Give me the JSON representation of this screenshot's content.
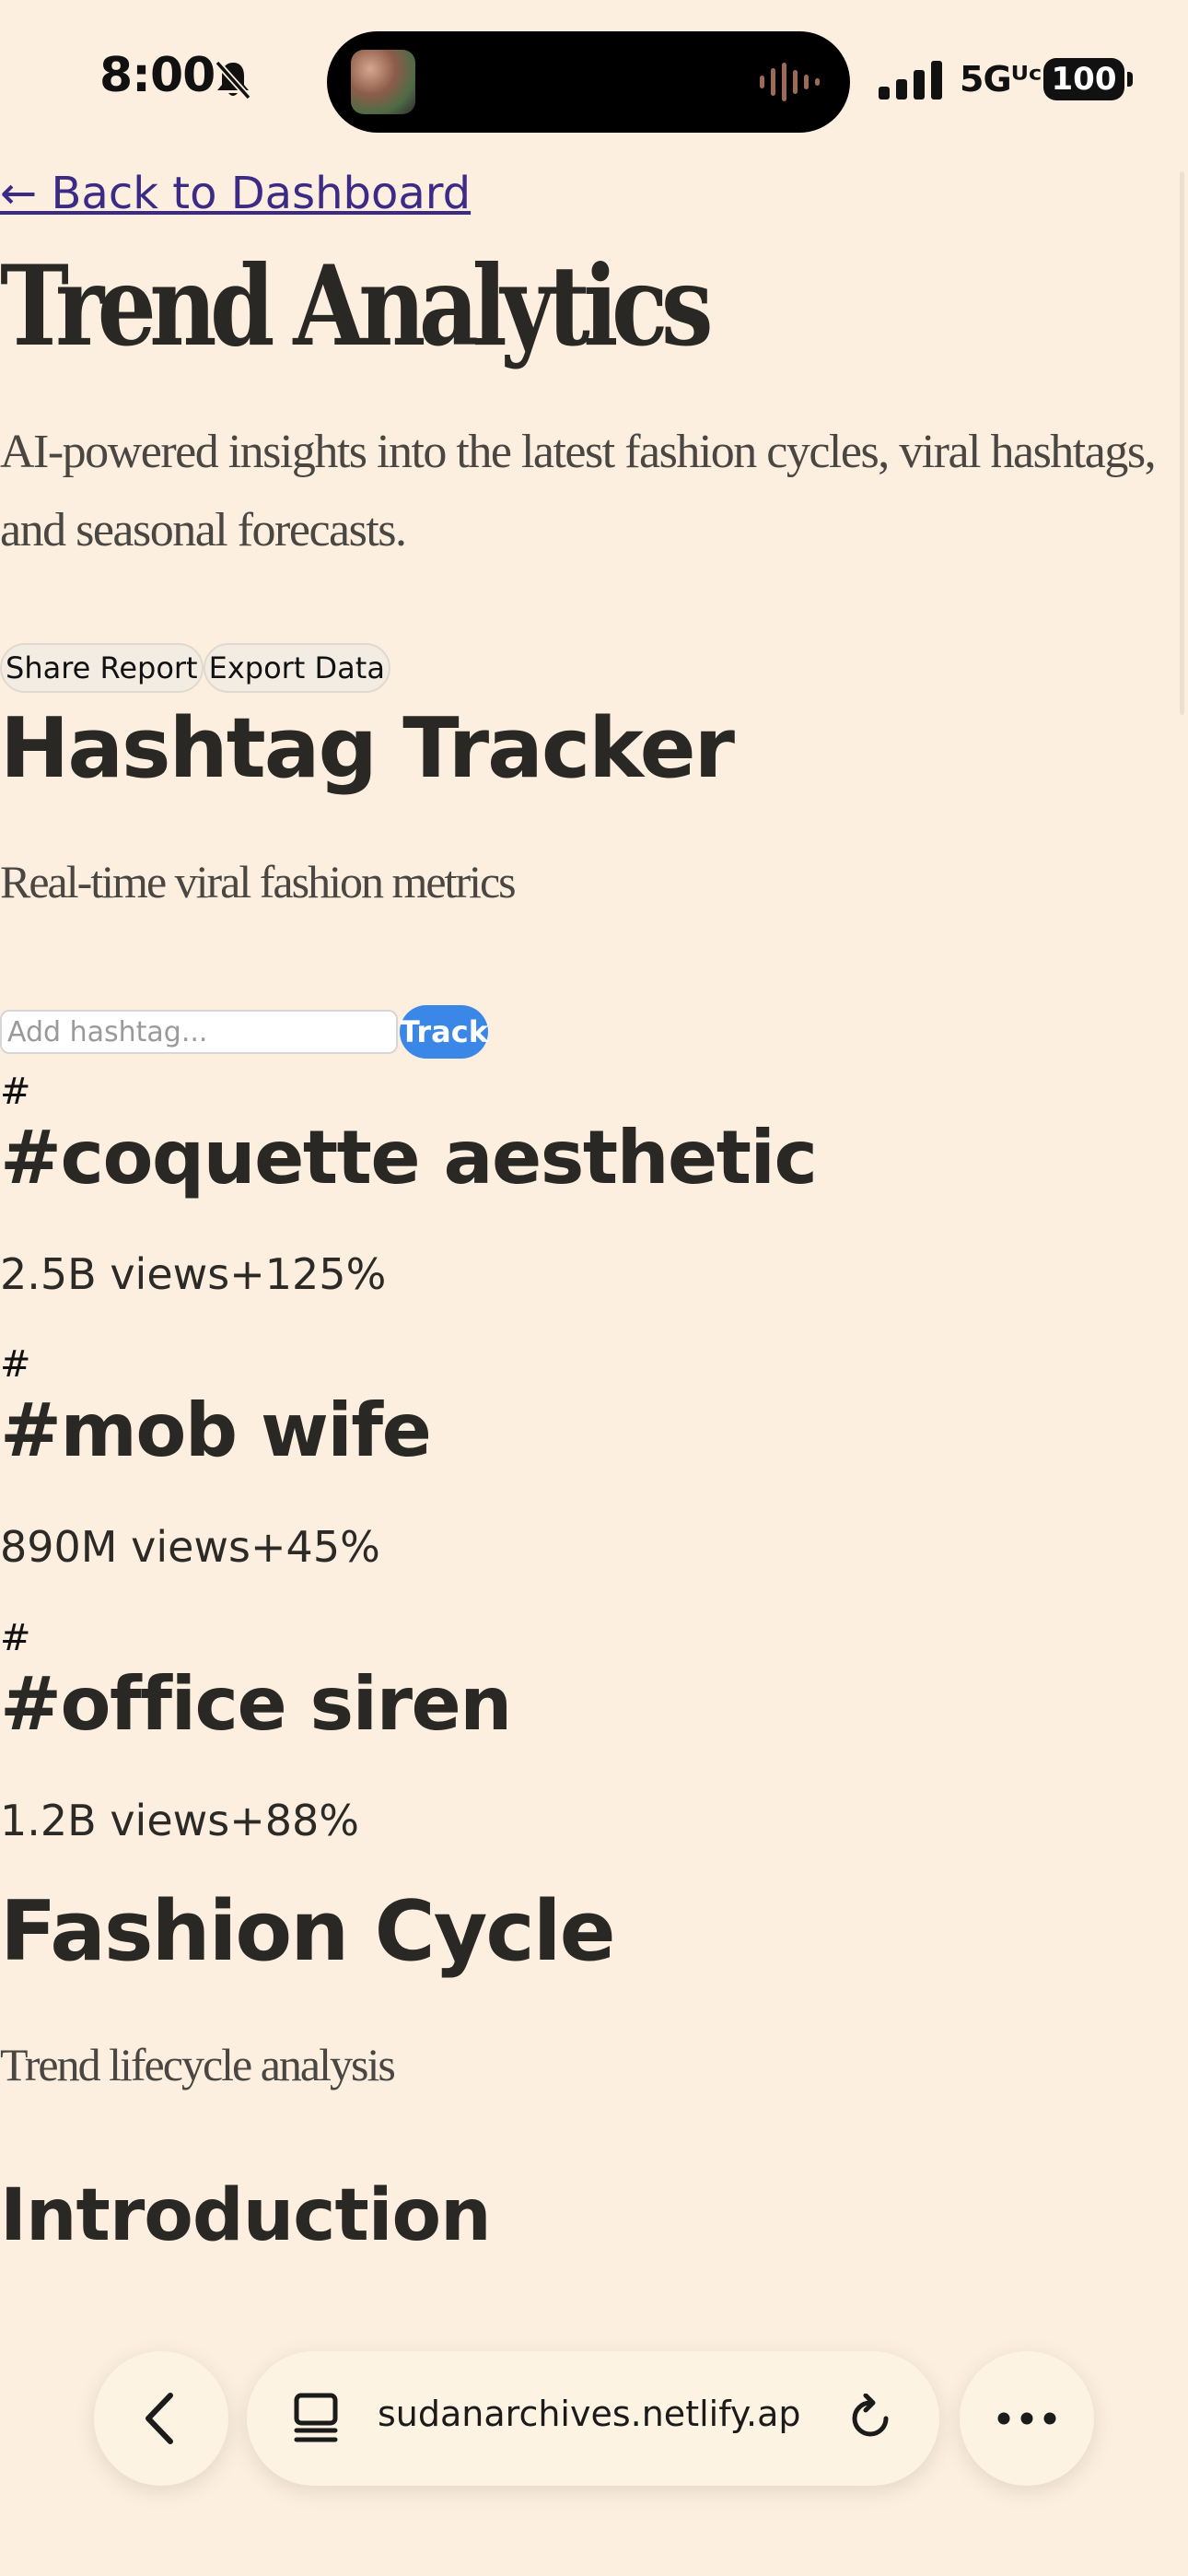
{
  "status_bar": {
    "time": "8:00",
    "network": "5Gᵁᶜ",
    "battery": "100"
  },
  "page": {
    "back_link": "← Back to Dashboard",
    "title": "Trend Analytics",
    "subtitle": "AI-powered insights into the latest fashion cycles, viral hashtags, and seasonal forecasts.",
    "share_button": "Share Report",
    "export_button": "Export Data"
  },
  "hashtag_tracker": {
    "title": "Hashtag Tracker",
    "subtitle": "Real-time viral fashion metrics",
    "input_placeholder": "Add hashtag...",
    "input_value": "",
    "track_button": "Track",
    "items": [
      {
        "icon": "#",
        "name": "#coquette aesthetic",
        "views": "2.5B views",
        "growth": "+125%"
      },
      {
        "icon": "#",
        "name": "#mob wife",
        "views": "890M views",
        "growth": "+45%"
      },
      {
        "icon": "#",
        "name": "#office siren",
        "views": "1.2B views",
        "growth": "+88%"
      }
    ]
  },
  "fashion_cycle": {
    "title": "Fashion Cycle",
    "subtitle": "Trend lifecycle analysis",
    "intro_heading": "Introduction"
  },
  "browser": {
    "url": "sudanarchives.netlify.app"
  },
  "icons": {
    "bell": "bell-slash-icon",
    "signal": "cellular-signal-icon",
    "back": "chevron-left-icon",
    "tabs": "tab-overview-icon",
    "reload": "reload-icon",
    "more": "more-icon"
  },
  "colors": {
    "background": "#fcefdf",
    "link": "#3b2a86",
    "accent": "#3a87e8",
    "text": "#292824"
  }
}
